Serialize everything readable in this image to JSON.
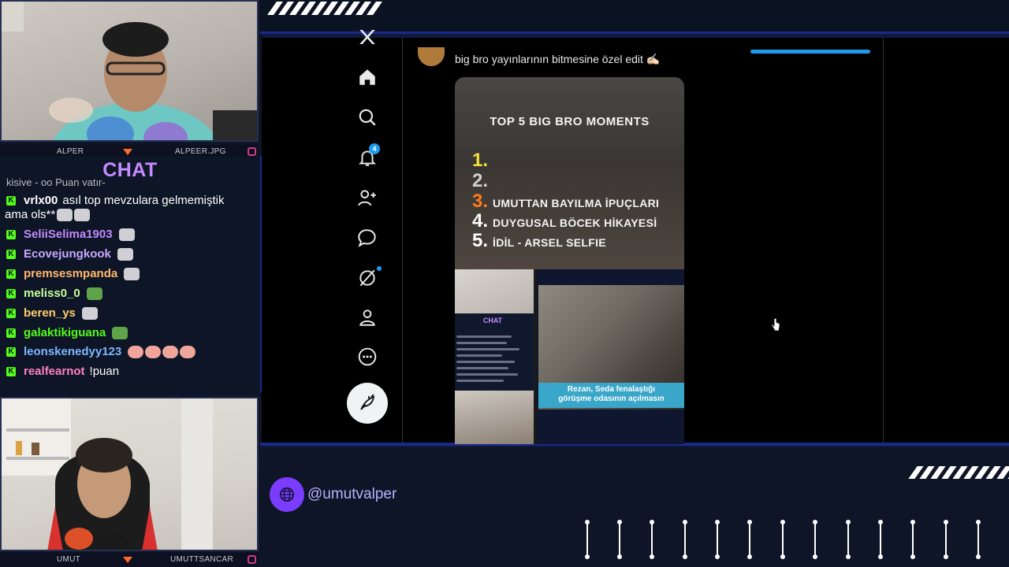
{
  "streamer_top": {
    "name": "ALPER",
    "handle": "ALPEER.JPG"
  },
  "streamer_bottom": {
    "name": "UMUT",
    "handle": "UMUTTSANCAR"
  },
  "chat": {
    "title": "CHAT",
    "truncated_line": "kişiye - oo Puan yatır-",
    "messages": [
      {
        "user": "vrlx00",
        "text": "asıl top mevzulara gelmemiştik",
        "continuation": "ama ols**",
        "color": "#ffffff",
        "emotes": [
          "cat-emote",
          "cat-emote"
        ]
      },
      {
        "user": "SeliiSelima1903",
        "text": "",
        "color": "#c48bff",
        "emotes": [
          "cat-emote"
        ]
      },
      {
        "user": "Ecovejungkook",
        "text": "",
        "color": "#c9a8ff",
        "emotes": [
          "cat-emote"
        ]
      },
      {
        "user": "premsesmpanda",
        "text": "",
        "color": "#ffb86b",
        "emotes": [
          "cat-emote"
        ]
      },
      {
        "user": "meliss0_0",
        "text": "",
        "color": "#c8ff9a",
        "emotes": [
          "frog-emote"
        ]
      },
      {
        "user": "beren_ys",
        "text": "",
        "color": "#ffcf6e",
        "emotes": [
          "cat-emote"
        ]
      },
      {
        "user": "galaktikiguana",
        "text": "",
        "color": "#53fc18",
        "emotes": [
          "frog-emote"
        ]
      },
      {
        "user": "leonskenedyy123",
        "text": "",
        "color": "#7eb6ff",
        "emotes": [
          "face-emote",
          "face-emote",
          "face-emote",
          "face-emote"
        ]
      },
      {
        "user": "realfearnot",
        "text": "!puan",
        "color": "#ff80c0",
        "emotes": []
      }
    ]
  },
  "twitter": {
    "notification_count": "4",
    "tweet_text": "big bro yayınlarının bitmesine özel edit ✍🏻"
  },
  "video": {
    "title": "TOP 5 BIG BRO MOMENTS",
    "ranks": [
      {
        "num": "1.",
        "text": "",
        "color": "#f5e03a"
      },
      {
        "num": "2.",
        "text": "",
        "color": "#d0d0d0"
      },
      {
        "num": "3.",
        "text": "UMUTTAN BAYILMA İPUÇLARI",
        "color": "#ff7a1a"
      },
      {
        "num": "4.",
        "text": "DUYGUSAL BÖCEK HİKAYESİ",
        "color": "#ffffff"
      },
      {
        "num": "5.",
        "text": "İDİL - ARSEL SELFIE",
        "color": "#ffffff"
      }
    ],
    "inner_chat_title": "CHAT",
    "caption_line1": "Rezan, Seda fenalaştığı",
    "caption_line2": "görüşme odasının açılmasın"
  },
  "social": {
    "handle": "@umutvalper",
    "icon": "globe-icon"
  }
}
